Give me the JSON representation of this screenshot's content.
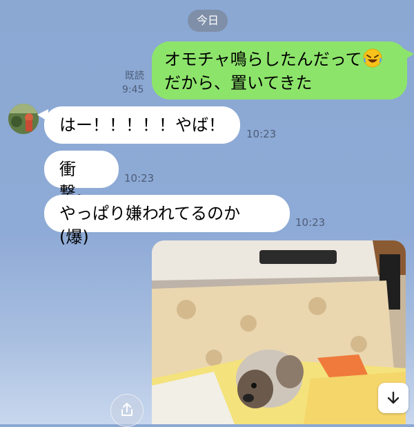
{
  "chat": {
    "date_label": "今日",
    "messages": [
      {
        "sender": "me",
        "line1": "オモチャ鳴らしたんだって",
        "emoji": "rolling-on-floor-laughing-emoji",
        "line2": "だから、置いてきた",
        "read_label": "既読",
        "time": "9:45"
      },
      {
        "sender": "friend",
        "text": "はー！！！！！やば！",
        "time": "10:23"
      },
      {
        "sender": "friend",
        "text": "衝撃。",
        "time": "10:23"
      },
      {
        "sender": "friend",
        "text": "やっぱり嫌われてるのか (爆)",
        "time": "10:23"
      }
    ],
    "photo": "dog-under-kotatsu-photo"
  },
  "controls": {
    "share_icon": "share-icon",
    "scroll_down_icon": "arrow-down-icon"
  },
  "colors": {
    "background": "#8eaad6",
    "outgoing_bubble": "#8de46b",
    "incoming_bubble": "#ffffff",
    "date_chip": "#7f8fa8"
  }
}
